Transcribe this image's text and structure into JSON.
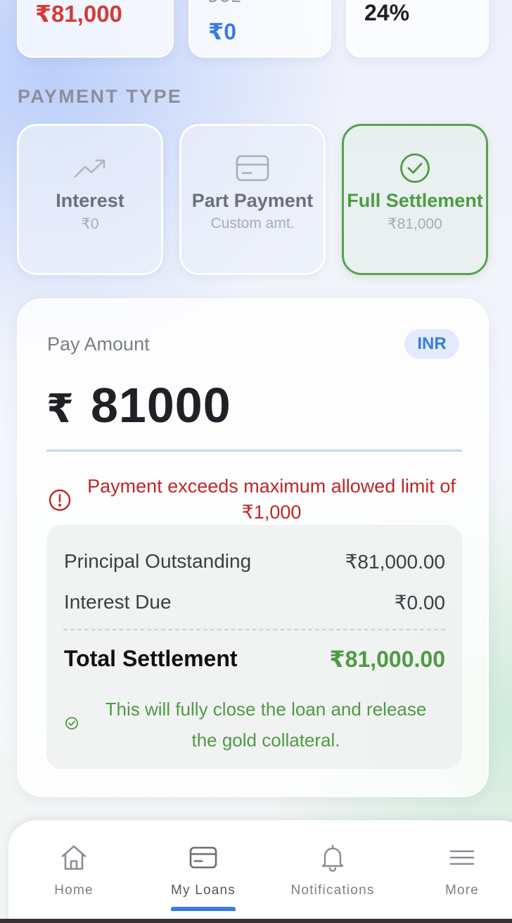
{
  "summary": {
    "card1_value": "₹81,000",
    "card2_label": "DUE",
    "card2_value": "₹0",
    "card3_value": "24%"
  },
  "payment_type": {
    "title": "PAYMENT TYPE",
    "options": [
      {
        "label": "Interest",
        "sub": "₹0",
        "icon": "trending-up-icon"
      },
      {
        "label": "Part Payment",
        "sub": "Custom amt.",
        "icon": "credit-card-icon"
      },
      {
        "label": "Full Settlement",
        "sub": "₹81,000",
        "icon": "check-circle-icon"
      }
    ],
    "selected": "Full Settlement"
  },
  "pay": {
    "label": "Pay Amount",
    "currency": "INR",
    "symbol": "₹",
    "amount": "81000",
    "error": "Payment exceeds maximum allowed limit of ₹1,000"
  },
  "breakdown": {
    "principal_label": "Principal Outstanding",
    "principal_value": "₹81,000.00",
    "interest_label": "Interest Due",
    "interest_value": "₹0.00",
    "total_label": "Total Settlement",
    "total_value": "₹81,000.00",
    "note": "This will fully close the loan and release the gold collateral."
  },
  "nav": {
    "items": [
      {
        "label": "Home",
        "icon": "home-icon"
      },
      {
        "label": "My Loans",
        "icon": "credit-card-icon"
      },
      {
        "label": "Notifications",
        "icon": "bell-icon"
      },
      {
        "label": "More",
        "icon": "menu-icon"
      }
    ],
    "active": "My Loans"
  },
  "colors": {
    "accent_blue": "#3b7be0",
    "success_green": "#4f9a45",
    "error_red": "#bf2626",
    "amount_red": "#d63a3a"
  }
}
